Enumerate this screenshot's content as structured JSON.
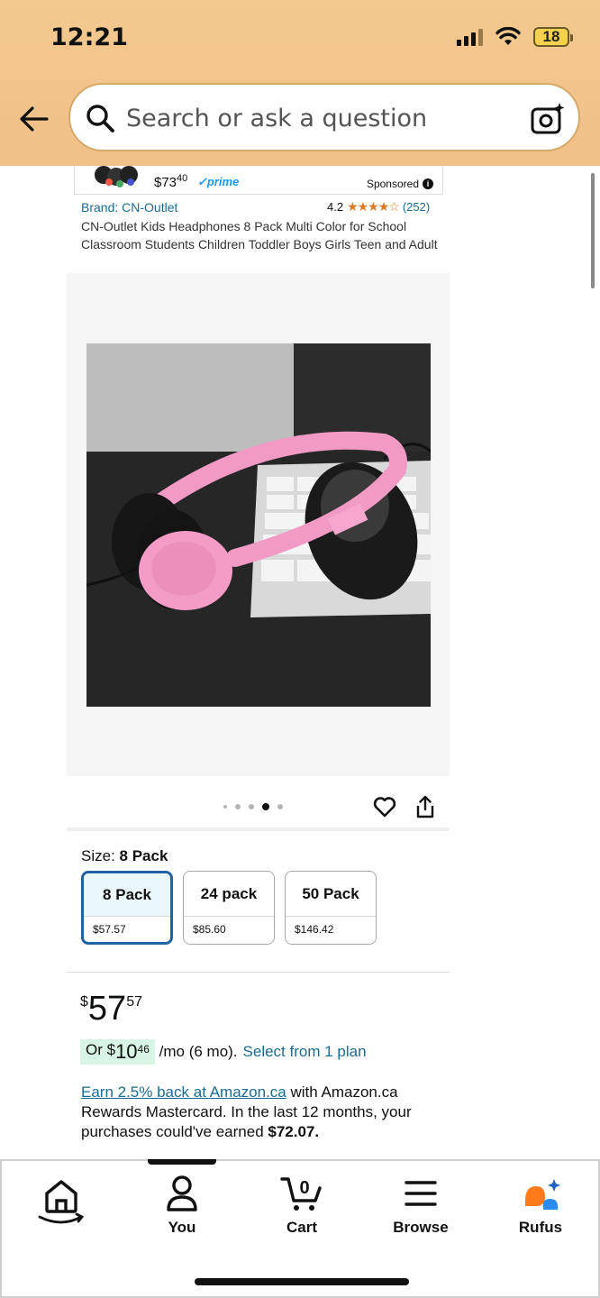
{
  "status_bar": {
    "time": "12:21",
    "battery": "18"
  },
  "search": {
    "placeholder": "Search or ask a question"
  },
  "sponsored_card": {
    "price_whole": "$73",
    "price_fraction": "40",
    "prime": "✓prime",
    "label": "Sponsored"
  },
  "product": {
    "brand": "Brand: CN-Outlet",
    "rating": "4.2",
    "stars": "★★★★☆",
    "rating_count": "(252)",
    "title": "CN-Outlet Kids Headphones 8 Pack Multi Color for School Classroom Students Children Toddler Boys Girls Teen and Adult",
    "image_index": 4,
    "image_count": 5
  },
  "size": {
    "label": "Size: ",
    "selected": "8 Pack",
    "options": [
      {
        "name": "8 Pack",
        "price": "$57.57"
      },
      {
        "name": "24 pack",
        "price": "$85.60"
      },
      {
        "name": "50 Pack",
        "price": "$146.42"
      }
    ]
  },
  "price": {
    "currency": "$",
    "whole": "57",
    "fraction": "57"
  },
  "monthly": {
    "prefix": "Or $",
    "whole": "10",
    "fraction": "46",
    "suffix": " /mo (6 mo).",
    "link": "Select from 1 plan"
  },
  "rewards": {
    "link": "Earn 2.5% back at Amazon.ca",
    "text": " with Amazon.ca Rewards Mastercard. In the last 12 months, your purchases could've earned ",
    "amount": "$72.07."
  },
  "nav": {
    "items": [
      {
        "label": "",
        "icon": "home-icon"
      },
      {
        "label": "You",
        "icon": "person-icon"
      },
      {
        "label": "Cart",
        "icon": "cart-icon",
        "badge": "0"
      },
      {
        "label": "Browse",
        "icon": "menu-icon"
      },
      {
        "label": "Rufus",
        "icon": "rufus-icon"
      }
    ]
  },
  "colors": {
    "header": "#f3c98f",
    "link": "#1a6b93",
    "selected_border": "#2162a1",
    "monthly_pill": "#d8f4e4",
    "stars": "#de7921"
  }
}
